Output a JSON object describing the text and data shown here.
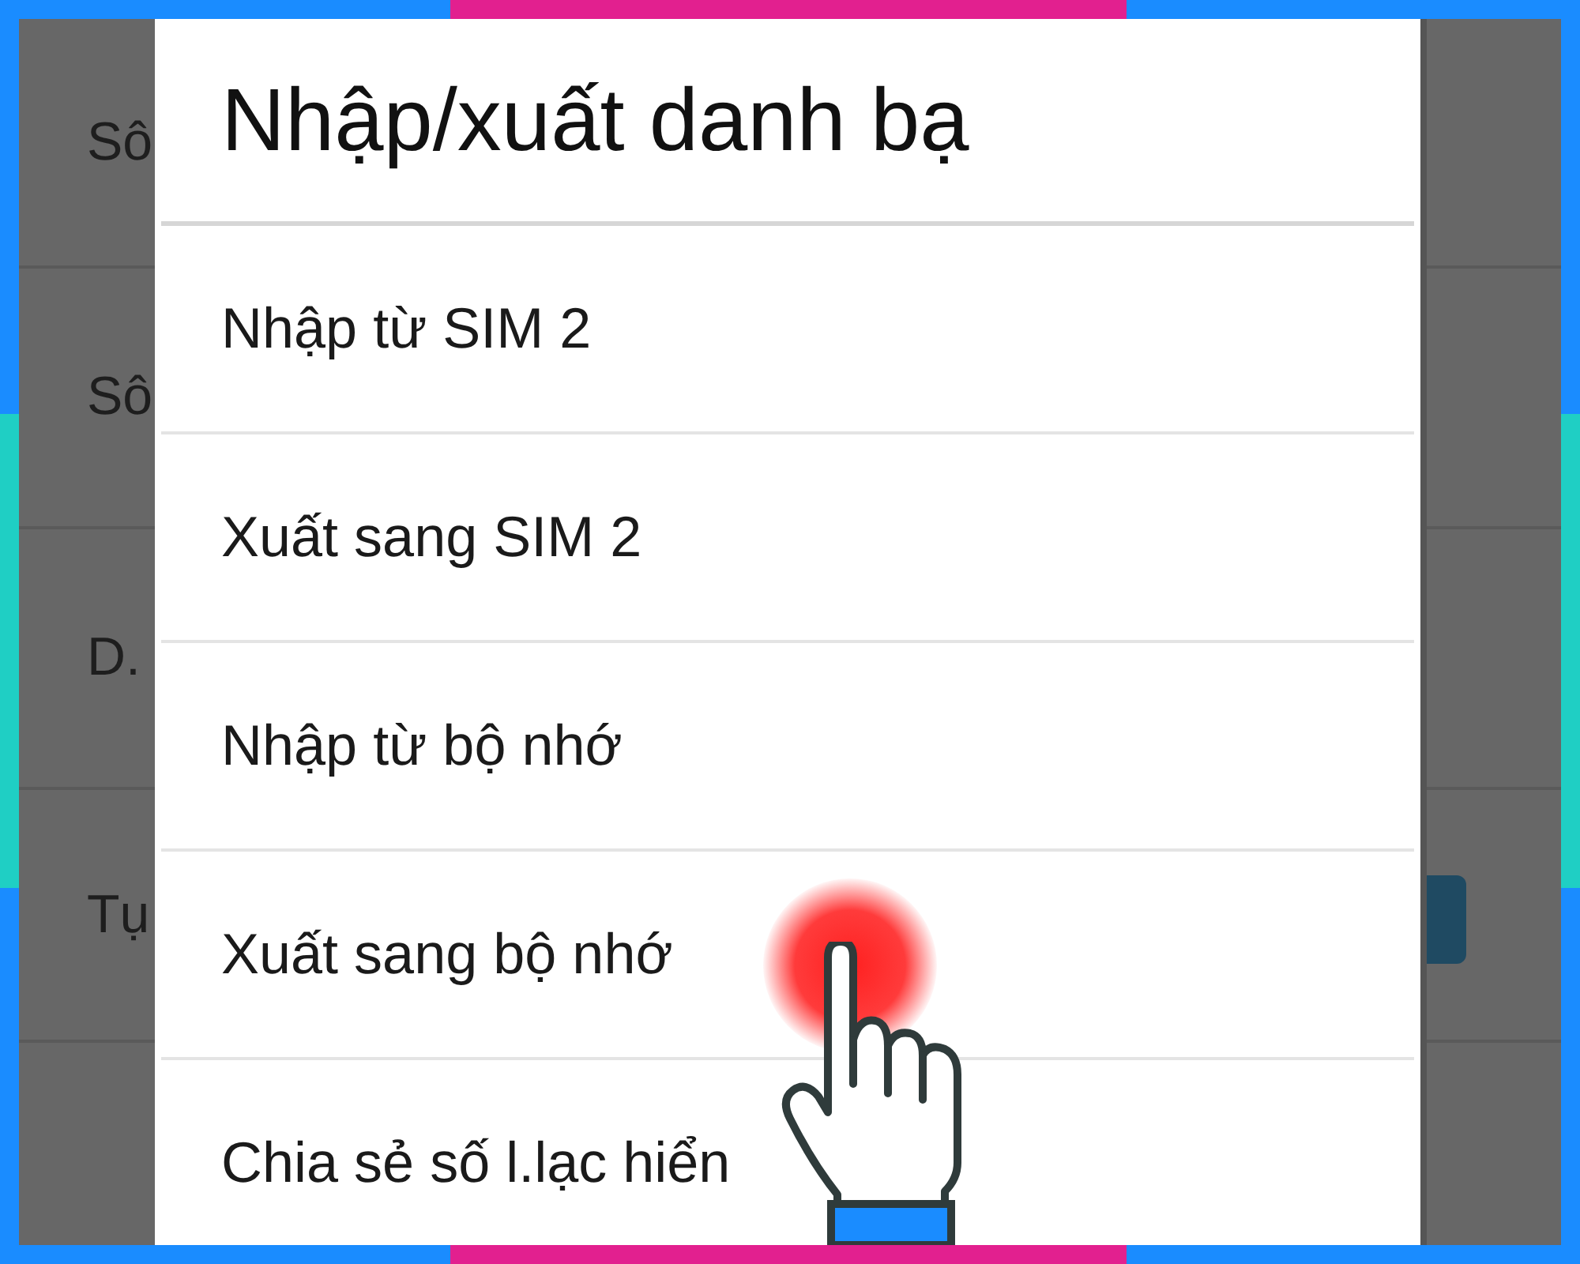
{
  "background_rows": [
    {
      "label": "Sô"
    },
    {
      "label": "Sô"
    },
    {
      "label": "D."
    },
    {
      "label": "Tụ",
      "checked": true
    }
  ],
  "dialog": {
    "title": "Nhập/xuất danh bạ",
    "items": [
      {
        "label": "Nhập từ SIM 2"
      },
      {
        "label": "Xuất sang SIM 2"
      },
      {
        "label": "Nhập từ bộ nhớ"
      },
      {
        "label": "Xuất sang bộ nhớ",
        "tapped": true
      },
      {
        "label": "Chia sẻ số l.lạc hiển"
      }
    ]
  }
}
